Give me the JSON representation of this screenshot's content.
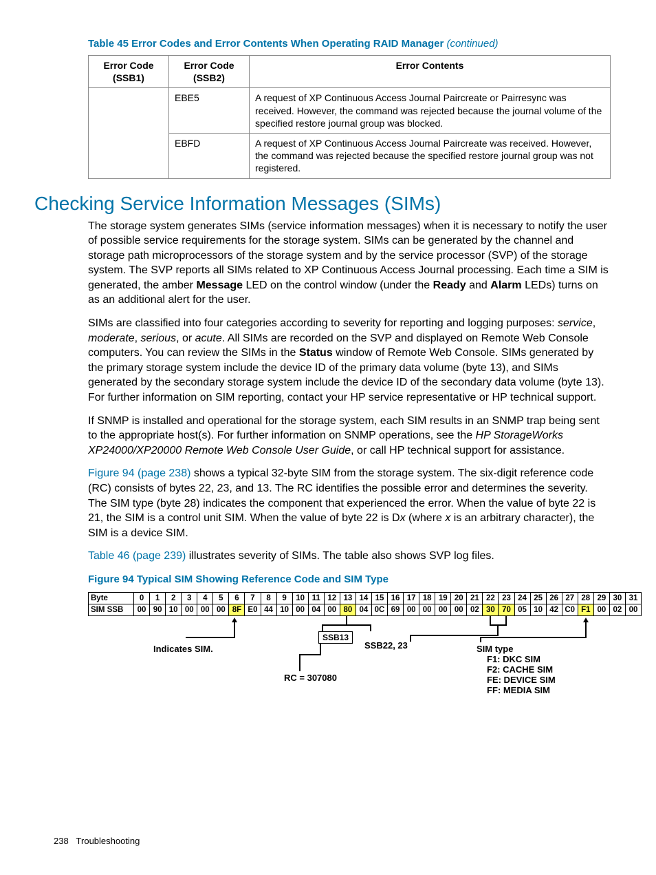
{
  "table": {
    "caption_main": "Table 45 Error Codes and Error Contents When Operating RAID Manager",
    "caption_cont": "(continued)",
    "headers": {
      "col1": "Error Code (SSB1)",
      "col2": "Error Code (SSB2)",
      "col3": "Error Contents"
    },
    "rows": [
      {
        "ssb1": "",
        "ssb2": "EBE5",
        "contents": "A request of XP Continuous Access Journal Paircreate or Pairresync was received. However, the command was rejected because the journal volume of the specified restore journal group was blocked."
      },
      {
        "ssb1": "",
        "ssb2": "EBFD",
        "contents": "A request of XP Continuous Access Journal Paircreate was received. However, the command was rejected because the specified restore journal group was not registered."
      }
    ]
  },
  "section_heading": "Checking Service Information Messages (SIMs)",
  "para1": {
    "t1": "The storage system generates SIMs (service information messages) when it is necessary to notify the user of possible service requirements for the storage system. SIMs can be generated by the channel and storage path microprocessors of the storage system and by the service processor (SVP) of the storage system. The SVP reports all SIMs related to XP Continuous Access Journal processing. Each time a SIM is generated, the amber ",
    "b1": "Message",
    "t2": " LED on the control window (under the ",
    "b2": "Ready",
    "t3": " and ",
    "b3": "Alarm",
    "t4": " LEDs) turns on as an additional alert for the user."
  },
  "para2": {
    "t1": "SIMs are classified into four categories according to severity for reporting and logging purposes: ",
    "i1": "service",
    "t2": ", ",
    "i2": "moderate",
    "t3": ", ",
    "i3": "serious",
    "t4": ", or ",
    "i4": "acute",
    "t5": ". All SIMs are recorded on the SVP and displayed on Remote Web Console computers. You can review the SIMs in the ",
    "b1": "Status",
    "t6": " window of Remote Web Console. SIMs generated by the primary storage system include the device ID of the primary data volume (byte 13), and SIMs generated by the secondary storage system include the device ID of the secondary data volume (byte 13). For further information on SIM reporting, contact your HP service representative or HP technical support."
  },
  "para3": {
    "t1": "If SNMP is installed and operational for the storage system, each SIM results in an SNMP trap being sent to the appropriate host(s). For further information on SNMP operations, see the ",
    "i1": "HP StorageWorks XP24000/XP20000 Remote Web Console User Guide",
    "t2": ", or call HP technical support for assistance."
  },
  "para4": {
    "link": "Figure 94 (page 238)",
    "t1": " shows a typical 32-byte SIM from the storage system. The six-digit reference code (RC) consists of bytes 22, 23, and 13. The RC identifies the possible error and determines the severity. The SIM type (byte 28) indicates the component that experienced the error. When the value of byte 22 is 21, the SIM is a control unit SIM. When the value of byte 22 is D",
    "i1": "x",
    "t2": " (where ",
    "i2": "x",
    "t3": " is an arbitrary character), the SIM is a device SIM."
  },
  "para5": {
    "link": "Table 46 (page 239)",
    "t1": " illustrates severity of SIMs. The table also shows SVP log files."
  },
  "figure_caption": "Figure 94 Typical SIM Showing Reference Code and SIM Type",
  "fig": {
    "row1_label": "Byte",
    "row2_label": "SIM SSB",
    "byte_nums": [
      "0",
      "1",
      "2",
      "3",
      "4",
      "5",
      "6",
      "7",
      "8",
      "9",
      "10",
      "11",
      "12",
      "13",
      "14",
      "15",
      "16",
      "17",
      "18",
      "19",
      "20",
      "21",
      "22",
      "23",
      "24",
      "25",
      "26",
      "27",
      "28",
      "29",
      "30",
      "31"
    ],
    "ssb_vals": [
      "00",
      "90",
      "10",
      "00",
      "00",
      "00",
      "8F",
      "E0",
      "44",
      "10",
      "00",
      "04",
      "00",
      "80",
      "04",
      "0C",
      "69",
      "00",
      "00",
      "00",
      "00",
      "02",
      "30",
      "70",
      "05",
      "10",
      "42",
      "C0",
      "F1",
      "00",
      "02",
      "00"
    ],
    "highlights": [
      6,
      13,
      22,
      23,
      28
    ],
    "labels": {
      "indicates_sim": "Indicates SIM.",
      "ssb13": "SSB13",
      "ssb2223": "SSB22, 23",
      "rc": "RC = 307080",
      "simtype_title": "SIM type",
      "simtype_lines": [
        "F1: DKC SIM",
        "F2: CACHE SIM",
        "FE: DEVICE SIM",
        "FF: MEDIA SIM"
      ]
    }
  },
  "footer": {
    "page": "238",
    "section": "Troubleshooting"
  }
}
